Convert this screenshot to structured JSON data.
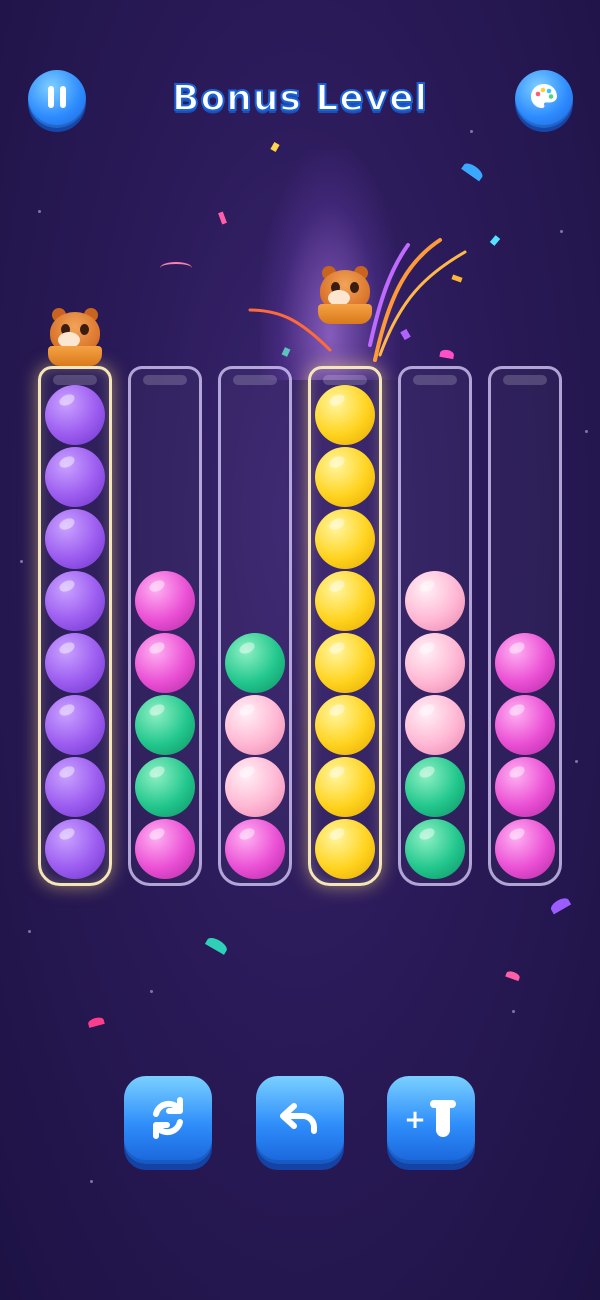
{
  "header": {
    "title": "Bonus Level",
    "left_button_icon": "pause-icon",
    "right_button_icon": "palette-icon"
  },
  "tubes": [
    {
      "balls": [
        "purple",
        "purple",
        "purple",
        "purple",
        "purple",
        "purple",
        "purple",
        "purple"
      ],
      "complete": true,
      "hamster": true
    },
    {
      "balls": [
        "magenta",
        "green",
        "green",
        "magenta",
        "magenta"
      ],
      "complete": false,
      "hamster": false
    },
    {
      "balls": [
        "magenta",
        "pink",
        "pink",
        "green"
      ],
      "complete": false,
      "hamster": false
    },
    {
      "balls": [
        "yellow",
        "yellow",
        "yellow",
        "yellow",
        "yellow",
        "yellow",
        "yellow",
        "yellow"
      ],
      "complete": true,
      "hamster": true
    },
    {
      "balls": [
        "green",
        "green",
        "pink",
        "pink",
        "pink"
      ],
      "complete": false,
      "hamster": false
    },
    {
      "balls": [
        "magenta",
        "magenta",
        "magenta",
        "magenta"
      ],
      "complete": false,
      "hamster": false
    }
  ],
  "toolbar": {
    "restart_icon": "restart-icon",
    "undo_icon": "undo-icon",
    "add_tube_icon": "add-tube-icon",
    "add_tube_label": "+"
  },
  "colors": {
    "purple": "#9c5cf0",
    "magenta": "#ea4fd4",
    "green": "#22c78d",
    "pink": "#ffb7d3",
    "yellow": "#ffd31f",
    "button_blue": "#2f8efa"
  }
}
